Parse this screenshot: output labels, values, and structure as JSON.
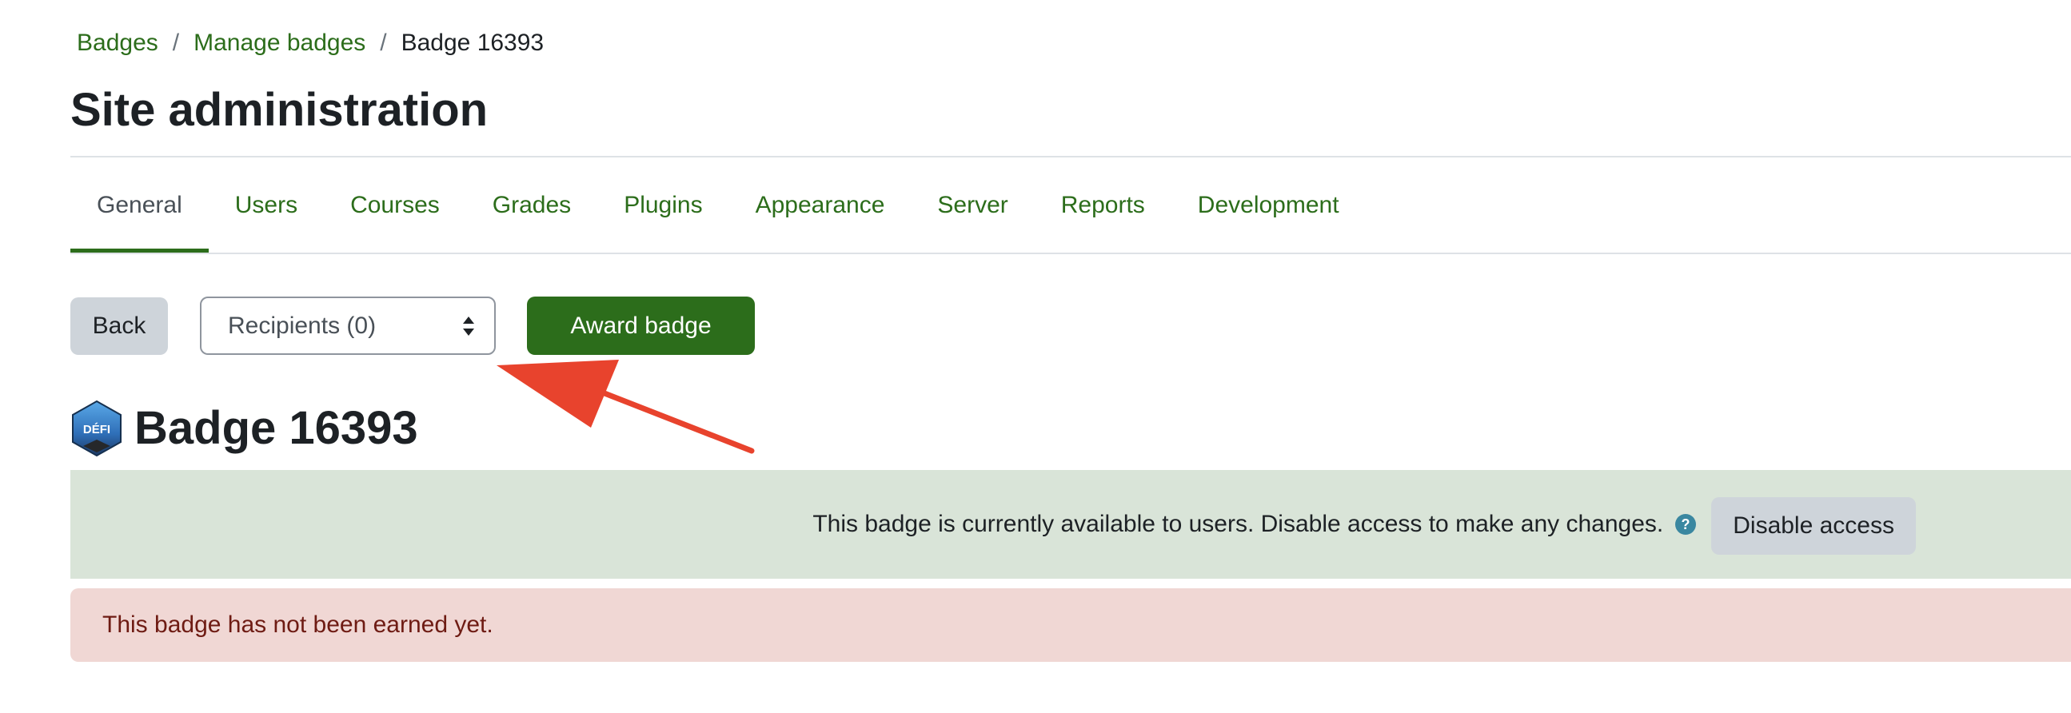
{
  "breadcrumb": {
    "items": [
      {
        "label": "Badges"
      },
      {
        "label": "Manage badges"
      }
    ],
    "separator": "/",
    "current": "Badge 16393"
  },
  "page_title": "Site administration",
  "tabs": [
    {
      "label": "General",
      "active": true
    },
    {
      "label": "Users"
    },
    {
      "label": "Courses"
    },
    {
      "label": "Grades"
    },
    {
      "label": "Plugins"
    },
    {
      "label": "Appearance"
    },
    {
      "label": "Server"
    },
    {
      "label": "Reports"
    },
    {
      "label": "Development"
    }
  ],
  "actions": {
    "back_label": "Back",
    "recipients_selected": "Recipients (0)",
    "award_label": "Award badge"
  },
  "badge": {
    "title": "Badge 16393",
    "logo_text": "DÉFI"
  },
  "status": {
    "message": "This badge is currently available to users. Disable access to make any changes.",
    "help_icon": "question-circle-icon",
    "disable_label": "Disable access"
  },
  "alert": {
    "message": "This badge has not been earned yet."
  },
  "colors": {
    "link_green": "#2c6d1b",
    "primary_button": "#2c6d1b",
    "secondary_button": "#ced4da",
    "success_bg": "#d9e4d8",
    "danger_bg": "#f0d7d4",
    "danger_text": "#6e1b13",
    "annotation_arrow": "#e8432d",
    "help_icon": "#3a87a0"
  }
}
